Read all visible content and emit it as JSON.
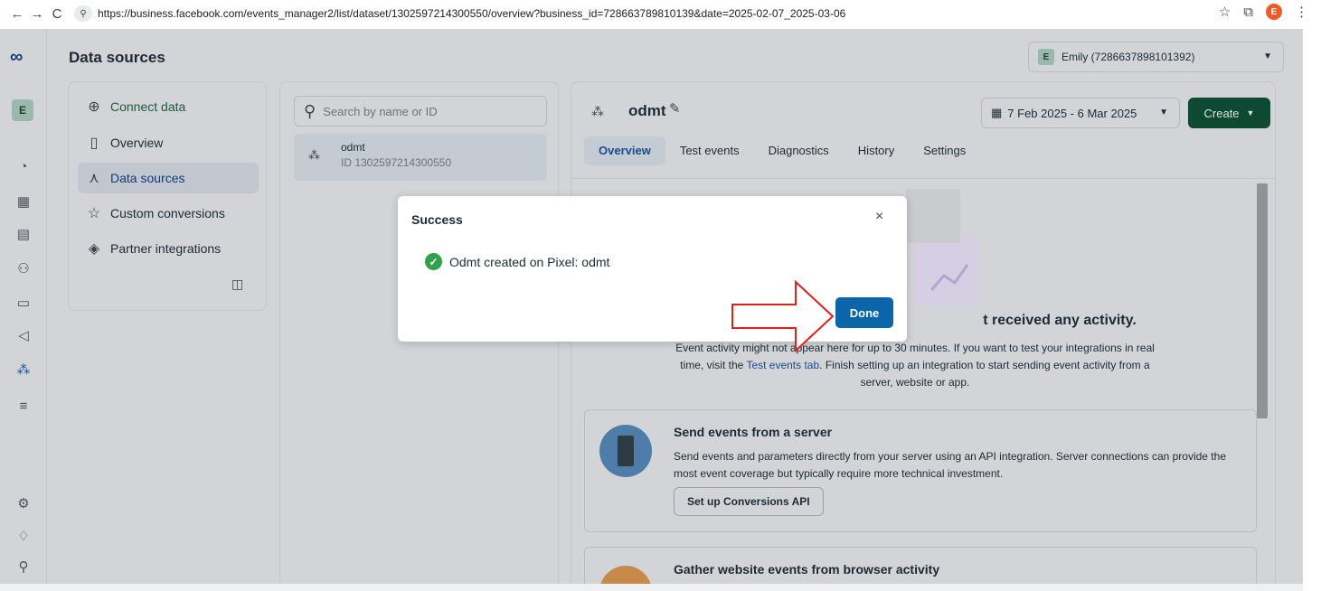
{
  "browser": {
    "back": "←",
    "forward": "→",
    "reload": "C",
    "url": "https://business.facebook.com/events_manager2/list/dataset/1302597214300550/overview?business_id=728663789810139&date=2025-02-07_2025-03-06",
    "star": "☆",
    "extensions": "⧉",
    "profile_initial": "E",
    "menu": "⋮"
  },
  "app": {
    "title": "Data sources",
    "account_initial": "E",
    "account_name": "Emily (7286637898101392)"
  },
  "side_nav": {
    "items": [
      {
        "label": "Connect data",
        "icon": "⊕"
      },
      {
        "label": "Overview",
        "icon": "▯"
      },
      {
        "label": "Data sources",
        "icon": "⋏"
      },
      {
        "label": "Custom conversions",
        "icon": "☆"
      },
      {
        "label": "Partner integrations",
        "icon": "◈"
      }
    ]
  },
  "list": {
    "search_placeholder": "Search by name or ID",
    "dataset_name": "odmt",
    "dataset_id": "ID 1302597214300550"
  },
  "detail": {
    "title": "odmt",
    "date_range": "7 Feb 2025 - 6 Mar 2025",
    "create_label": "Create",
    "tabs": [
      "Overview",
      "Test events",
      "Diagnostics",
      "History",
      "Settings"
    ],
    "empty_title_tail": "t received any activity.",
    "empty_desc_1": "Event activity might not appear here for up to 30 minutes. If you want to test your integrations in real time, visit the ",
    "empty_desc_link": "Test events tab",
    "empty_desc_2": ". Finish setting up an integration to start sending event activity from a server, website or app.",
    "card_server_title": "Send events from a server",
    "card_server_desc": "Send events and parameters directly from your server using an API integration. Server connections can provide the most event coverage but typically require more technical investment.",
    "card_server_button": "Set up Conversions API",
    "card_web_title": "Gather website events from browser activity"
  },
  "modal": {
    "title": "Success",
    "close": "×",
    "check": "✓",
    "message": "Odmt created on Pixel: odmt",
    "done_label": "Done"
  },
  "colors": {
    "accent_blue": "#0a66a8",
    "create_green": "#0e4a33",
    "success_green": "#30a24c",
    "annotation_red": "#e0201b"
  }
}
